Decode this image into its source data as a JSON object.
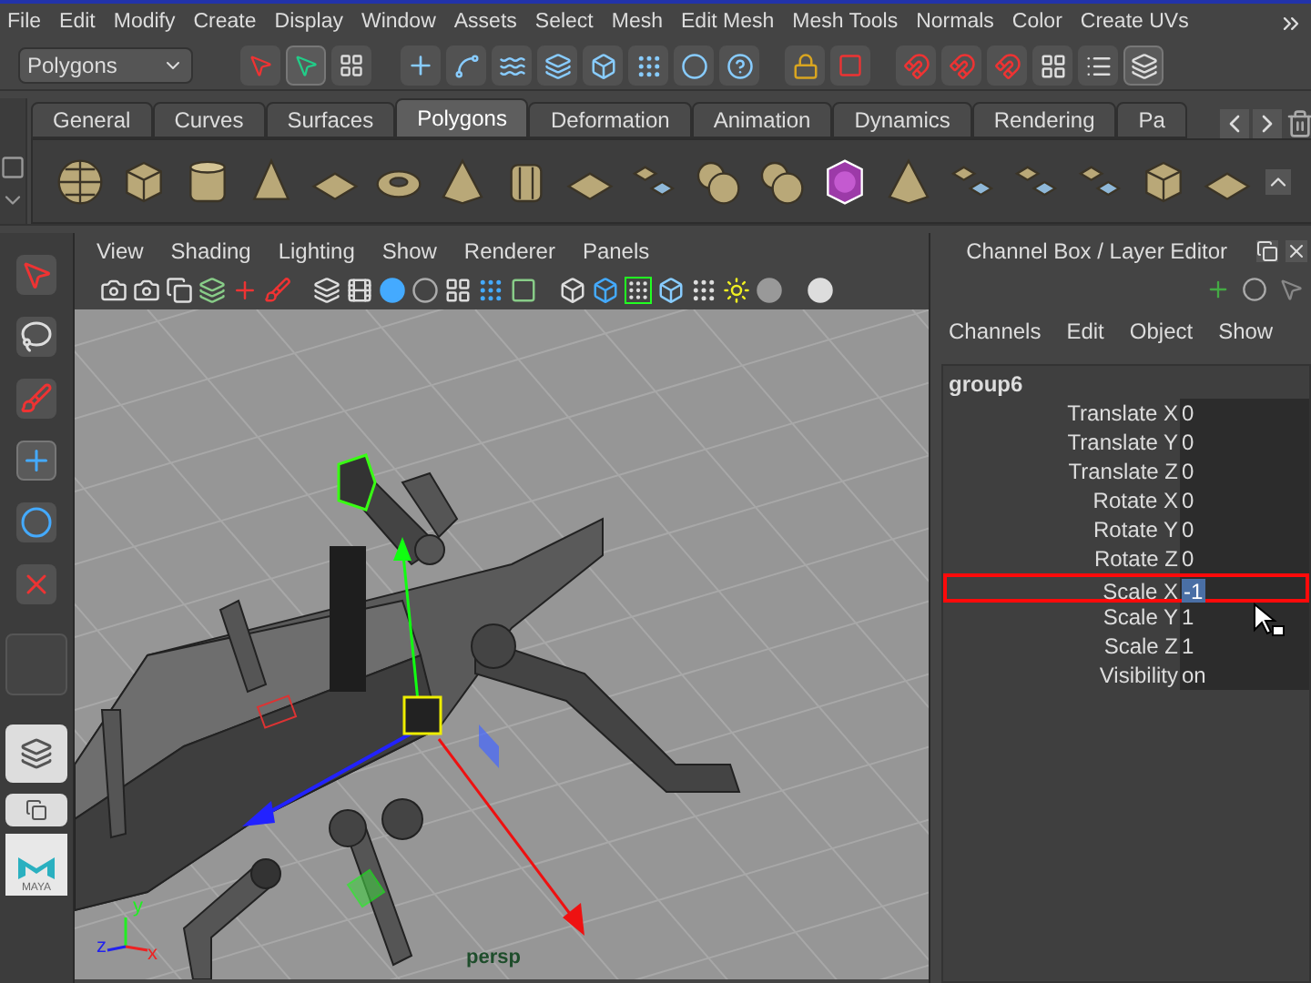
{
  "menu_bar": [
    "File",
    "Edit",
    "Modify",
    "Create",
    "Display",
    "Window",
    "Assets",
    "Select",
    "Mesh",
    "Edit Mesh",
    "Mesh Tools",
    "Normals",
    "Color",
    "Create UVs"
  ],
  "status_line": {
    "mode": "Polygons"
  },
  "shelf": {
    "tabs": [
      {
        "label": "General",
        "selected": false
      },
      {
        "label": "Curves",
        "selected": false
      },
      {
        "label": "Surfaces",
        "selected": false
      },
      {
        "label": "Polygons",
        "selected": true
      },
      {
        "label": "Deformation",
        "selected": false
      },
      {
        "label": "Animation",
        "selected": false
      },
      {
        "label": "Dynamics",
        "selected": false
      },
      {
        "label": "Rendering",
        "selected": false
      },
      {
        "label": "Pa",
        "selected": false
      }
    ]
  },
  "viewport": {
    "menu": [
      "View",
      "Shading",
      "Lighting",
      "Show",
      "Renderer",
      "Panels"
    ],
    "axis_labels": [
      "x",
      "y",
      "z"
    ],
    "camera": "persp"
  },
  "toolbox": {
    "logo": "MAYA"
  },
  "channel_box": {
    "title": "Channel Box / Layer Editor",
    "menu": [
      "Channels",
      "Edit",
      "Object",
      "Show"
    ],
    "object": "group6",
    "attributes": [
      {
        "name": "Translate X",
        "value": "0",
        "selected": false
      },
      {
        "name": "Translate Y",
        "value": "0",
        "selected": false
      },
      {
        "name": "Translate Z",
        "value": "0",
        "selected": false
      },
      {
        "name": "Rotate X",
        "value": "0",
        "selected": false
      },
      {
        "name": "Rotate Y",
        "value": "0",
        "selected": false
      },
      {
        "name": "Rotate Z",
        "value": "0",
        "selected": false
      },
      {
        "name": "Scale X",
        "value": "-1",
        "selected": true
      },
      {
        "name": "Scale Y",
        "value": "1",
        "selected": false
      },
      {
        "name": "Scale Z",
        "value": "1",
        "selected": false
      },
      {
        "name": "Visibility",
        "value": "on",
        "selected": false
      }
    ]
  }
}
